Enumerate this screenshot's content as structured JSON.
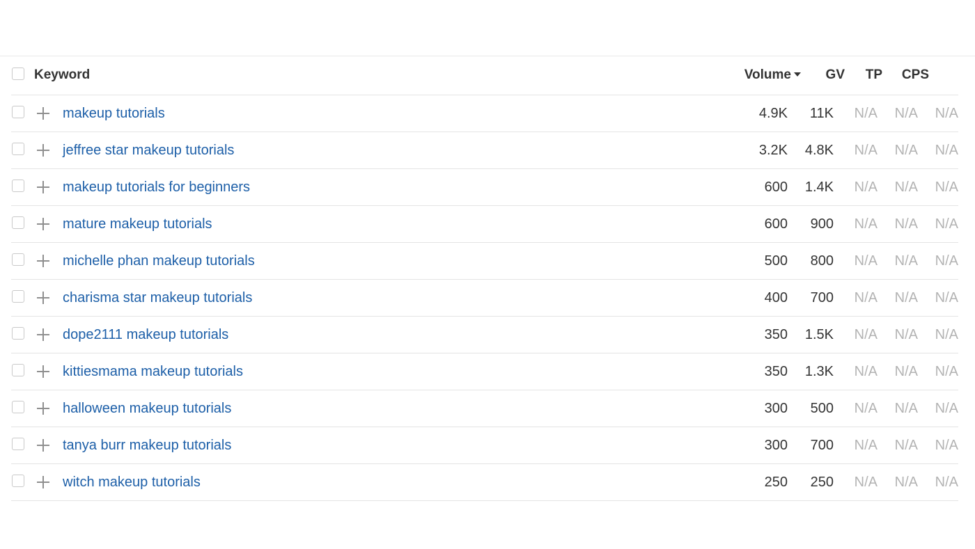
{
  "table": {
    "headers": {
      "keyword": "Keyword",
      "volume": "Volume",
      "gv": "GV",
      "tp": "TP",
      "cps": "CPS"
    },
    "sort": {
      "column": "volume",
      "direction": "descending"
    },
    "rows": [
      {
        "keyword": "makeup tutorials",
        "volume": "4.9K",
        "gv": "11K",
        "tp": "N/A",
        "cps": "N/A",
        "extra": "N/A"
      },
      {
        "keyword": "jeffree star makeup tutorials",
        "volume": "3.2K",
        "gv": "4.8K",
        "tp": "N/A",
        "cps": "N/A",
        "extra": "N/A"
      },
      {
        "keyword": "makeup tutorials for beginners",
        "volume": "600",
        "gv": "1.4K",
        "tp": "N/A",
        "cps": "N/A",
        "extra": "N/A"
      },
      {
        "keyword": "mature makeup tutorials",
        "volume": "600",
        "gv": "900",
        "tp": "N/A",
        "cps": "N/A",
        "extra": "N/A"
      },
      {
        "keyword": "michelle phan makeup tutorials",
        "volume": "500",
        "gv": "800",
        "tp": "N/A",
        "cps": "N/A",
        "extra": "N/A"
      },
      {
        "keyword": "charisma star makeup tutorials",
        "volume": "400",
        "gv": "700",
        "tp": "N/A",
        "cps": "N/A",
        "extra": "N/A"
      },
      {
        "keyword": "dope2111 makeup tutorials",
        "volume": "350",
        "gv": "1.5K",
        "tp": "N/A",
        "cps": "N/A",
        "extra": "N/A"
      },
      {
        "keyword": "kittiesmama makeup tutorials",
        "volume": "350",
        "gv": "1.3K",
        "tp": "N/A",
        "cps": "N/A",
        "extra": "N/A"
      },
      {
        "keyword": "halloween makeup tutorials",
        "volume": "300",
        "gv": "500",
        "tp": "N/A",
        "cps": "N/A",
        "extra": "N/A"
      },
      {
        "keyword": "tanya burr makeup tutorials",
        "volume": "300",
        "gv": "700",
        "tp": "N/A",
        "cps": "N/A",
        "extra": "N/A"
      },
      {
        "keyword": "witch makeup tutorials",
        "volume": "250",
        "gv": "250",
        "tp": "N/A",
        "cps": "N/A",
        "extra": "N/A"
      }
    ]
  },
  "colors": {
    "keyword_link": "#1d5fa8",
    "text": "#333333",
    "muted": "#b3b3b3",
    "divider": "#e4e4e4"
  },
  "icons": {
    "sort": "caret-down-icon",
    "add": "plus-icon",
    "select": "checkbox"
  }
}
